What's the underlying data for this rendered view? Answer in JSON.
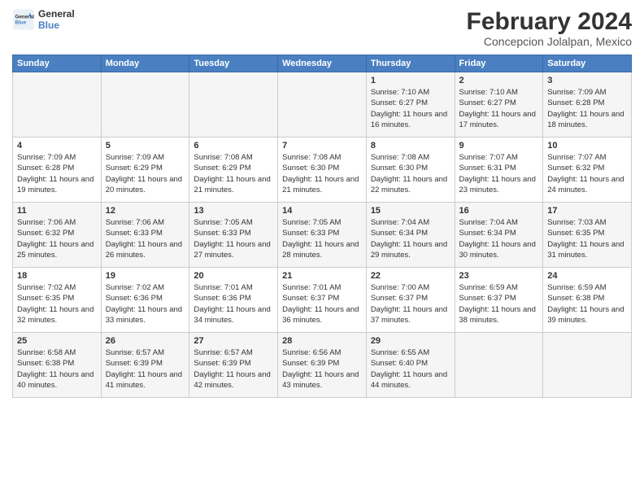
{
  "logo": {
    "line1": "General",
    "line2": "Blue"
  },
  "title": "February 2024",
  "location": "Concepcion Jolalpan, Mexico",
  "weekdays": [
    "Sunday",
    "Monday",
    "Tuesday",
    "Wednesday",
    "Thursday",
    "Friday",
    "Saturday"
  ],
  "weeks": [
    [
      {
        "day": "",
        "info": ""
      },
      {
        "day": "",
        "info": ""
      },
      {
        "day": "",
        "info": ""
      },
      {
        "day": "",
        "info": ""
      },
      {
        "day": "1",
        "info": "Sunrise: 7:10 AM\nSunset: 6:27 PM\nDaylight: 11 hours and 16 minutes."
      },
      {
        "day": "2",
        "info": "Sunrise: 7:10 AM\nSunset: 6:27 PM\nDaylight: 11 hours and 17 minutes."
      },
      {
        "day": "3",
        "info": "Sunrise: 7:09 AM\nSunset: 6:28 PM\nDaylight: 11 hours and 18 minutes."
      }
    ],
    [
      {
        "day": "4",
        "info": "Sunrise: 7:09 AM\nSunset: 6:28 PM\nDaylight: 11 hours and 19 minutes."
      },
      {
        "day": "5",
        "info": "Sunrise: 7:09 AM\nSunset: 6:29 PM\nDaylight: 11 hours and 20 minutes."
      },
      {
        "day": "6",
        "info": "Sunrise: 7:08 AM\nSunset: 6:29 PM\nDaylight: 11 hours and 21 minutes."
      },
      {
        "day": "7",
        "info": "Sunrise: 7:08 AM\nSunset: 6:30 PM\nDaylight: 11 hours and 21 minutes."
      },
      {
        "day": "8",
        "info": "Sunrise: 7:08 AM\nSunset: 6:30 PM\nDaylight: 11 hours and 22 minutes."
      },
      {
        "day": "9",
        "info": "Sunrise: 7:07 AM\nSunset: 6:31 PM\nDaylight: 11 hours and 23 minutes."
      },
      {
        "day": "10",
        "info": "Sunrise: 7:07 AM\nSunset: 6:32 PM\nDaylight: 11 hours and 24 minutes."
      }
    ],
    [
      {
        "day": "11",
        "info": "Sunrise: 7:06 AM\nSunset: 6:32 PM\nDaylight: 11 hours and 25 minutes."
      },
      {
        "day": "12",
        "info": "Sunrise: 7:06 AM\nSunset: 6:33 PM\nDaylight: 11 hours and 26 minutes."
      },
      {
        "day": "13",
        "info": "Sunrise: 7:05 AM\nSunset: 6:33 PM\nDaylight: 11 hours and 27 minutes."
      },
      {
        "day": "14",
        "info": "Sunrise: 7:05 AM\nSunset: 6:33 PM\nDaylight: 11 hours and 28 minutes."
      },
      {
        "day": "15",
        "info": "Sunrise: 7:04 AM\nSunset: 6:34 PM\nDaylight: 11 hours and 29 minutes."
      },
      {
        "day": "16",
        "info": "Sunrise: 7:04 AM\nSunset: 6:34 PM\nDaylight: 11 hours and 30 minutes."
      },
      {
        "day": "17",
        "info": "Sunrise: 7:03 AM\nSunset: 6:35 PM\nDaylight: 11 hours and 31 minutes."
      }
    ],
    [
      {
        "day": "18",
        "info": "Sunrise: 7:02 AM\nSunset: 6:35 PM\nDaylight: 11 hours and 32 minutes."
      },
      {
        "day": "19",
        "info": "Sunrise: 7:02 AM\nSunset: 6:36 PM\nDaylight: 11 hours and 33 minutes."
      },
      {
        "day": "20",
        "info": "Sunrise: 7:01 AM\nSunset: 6:36 PM\nDaylight: 11 hours and 34 minutes."
      },
      {
        "day": "21",
        "info": "Sunrise: 7:01 AM\nSunset: 6:37 PM\nDaylight: 11 hours and 36 minutes."
      },
      {
        "day": "22",
        "info": "Sunrise: 7:00 AM\nSunset: 6:37 PM\nDaylight: 11 hours and 37 minutes."
      },
      {
        "day": "23",
        "info": "Sunrise: 6:59 AM\nSunset: 6:37 PM\nDaylight: 11 hours and 38 minutes."
      },
      {
        "day": "24",
        "info": "Sunrise: 6:59 AM\nSunset: 6:38 PM\nDaylight: 11 hours and 39 minutes."
      }
    ],
    [
      {
        "day": "25",
        "info": "Sunrise: 6:58 AM\nSunset: 6:38 PM\nDaylight: 11 hours and 40 minutes."
      },
      {
        "day": "26",
        "info": "Sunrise: 6:57 AM\nSunset: 6:39 PM\nDaylight: 11 hours and 41 minutes."
      },
      {
        "day": "27",
        "info": "Sunrise: 6:57 AM\nSunset: 6:39 PM\nDaylight: 11 hours and 42 minutes."
      },
      {
        "day": "28",
        "info": "Sunrise: 6:56 AM\nSunset: 6:39 PM\nDaylight: 11 hours and 43 minutes."
      },
      {
        "day": "29",
        "info": "Sunrise: 6:55 AM\nSunset: 6:40 PM\nDaylight: 11 hours and 44 minutes."
      },
      {
        "day": "",
        "info": ""
      },
      {
        "day": "",
        "info": ""
      }
    ]
  ]
}
